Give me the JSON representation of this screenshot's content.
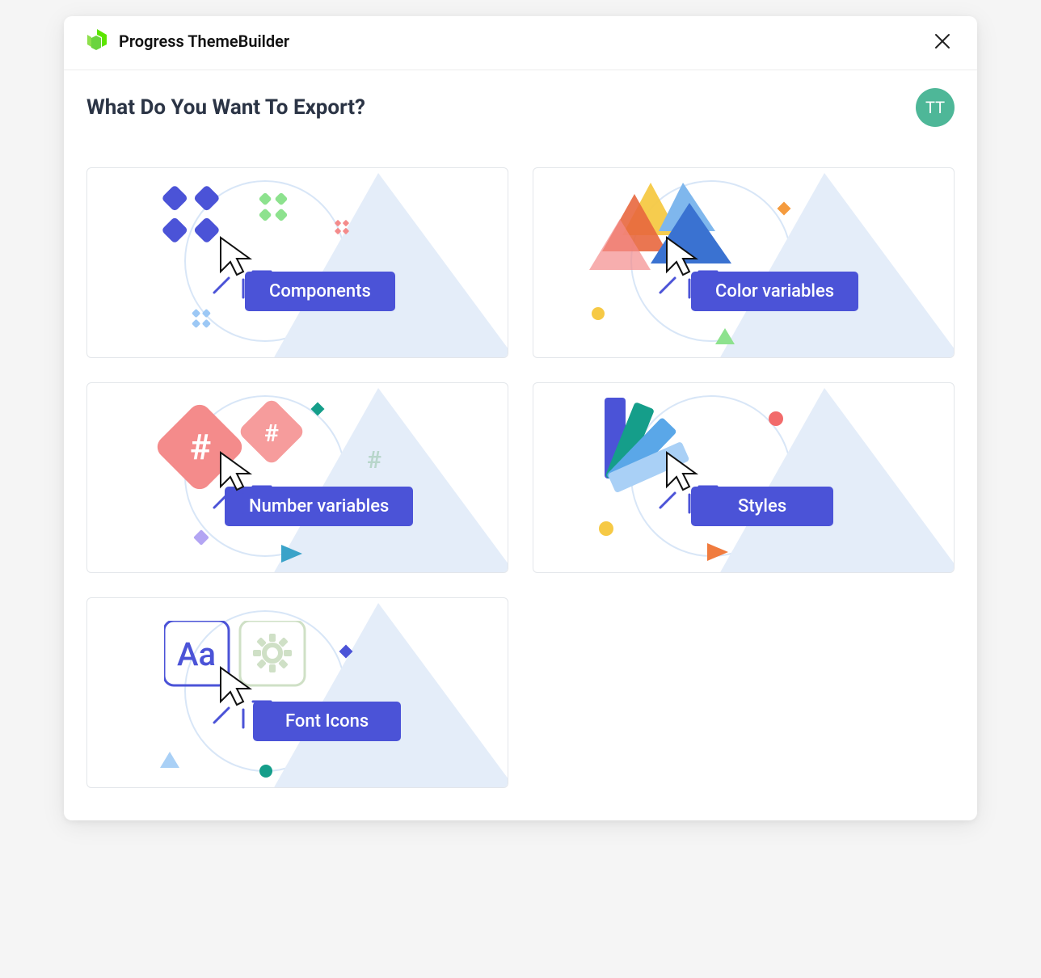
{
  "header": {
    "brand": "Progress ThemeBuilder"
  },
  "page": {
    "title": "What Do You Want To Export?",
    "avatar_initials": "TT"
  },
  "cards": [
    {
      "label": "Components"
    },
    {
      "label": "Color variables"
    },
    {
      "label": "Number variables"
    },
    {
      "label": "Styles"
    },
    {
      "label": "Font Icons"
    }
  ]
}
